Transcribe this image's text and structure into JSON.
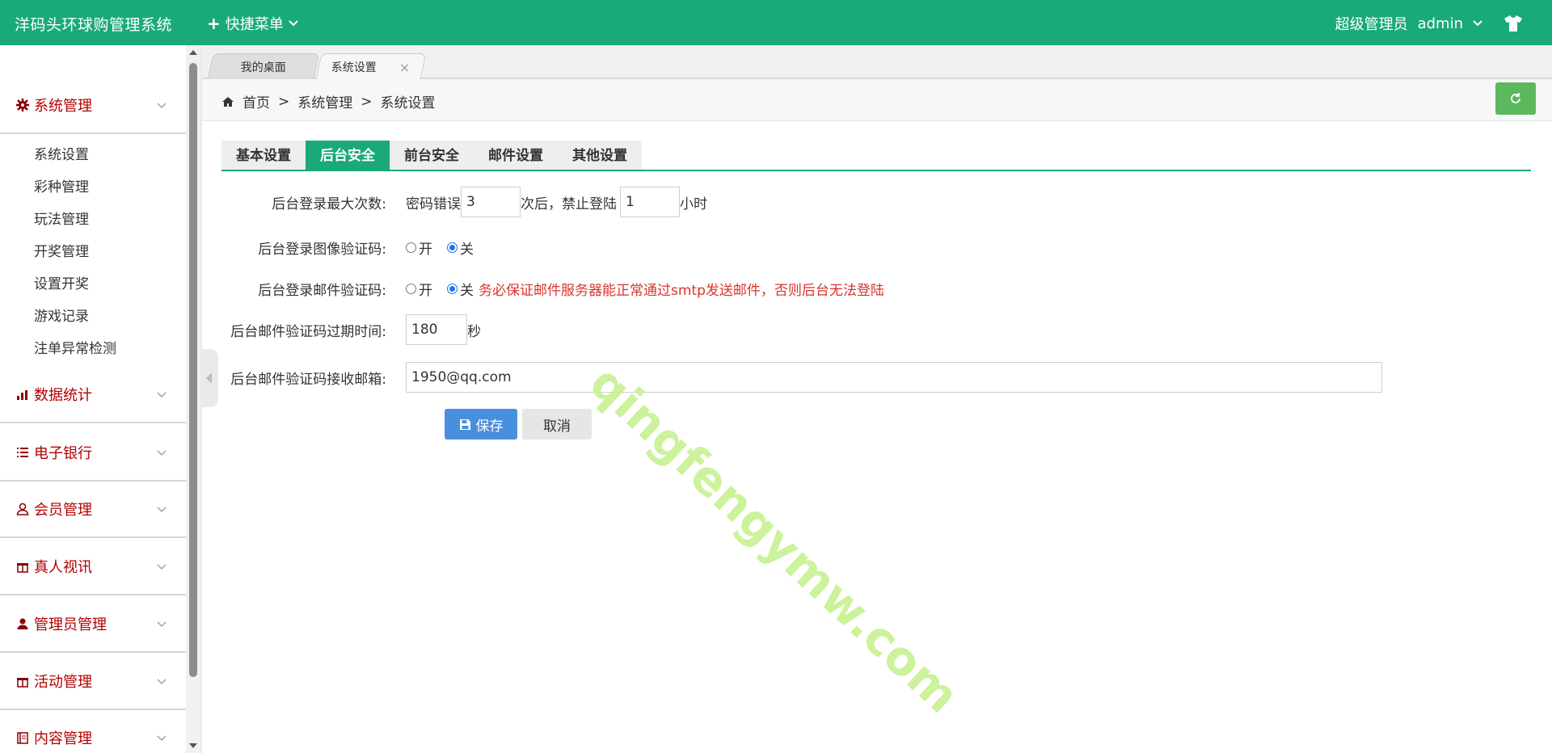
{
  "header": {
    "app_title": "洋码头环球购管理系统",
    "quick_menu": "快捷菜单",
    "role": "超级管理员",
    "username": "admin"
  },
  "sidebar": {
    "groups": [
      {
        "label": "系统管理",
        "icon": "gear-icon",
        "expanded": true,
        "items": [
          "系统设置",
          "彩种管理",
          "玩法管理",
          "开奖管理",
          "设置开奖",
          "游戏记录",
          "注单异常检测"
        ]
      },
      {
        "label": "数据统计",
        "icon": "bar-chart-icon"
      },
      {
        "label": "电子银行",
        "icon": "list-icon"
      },
      {
        "label": "会员管理",
        "icon": "user-icon"
      },
      {
        "label": "真人视讯",
        "icon": "gift-icon"
      },
      {
        "label": "管理员管理",
        "icon": "user-filled-icon"
      },
      {
        "label": "活动管理",
        "icon": "gift-icon"
      },
      {
        "label": "内容管理",
        "icon": "book-icon"
      }
    ]
  },
  "tabs": {
    "desktop": "我的桌面",
    "current": "系统设置",
    "close": "×"
  },
  "breadcrumb": {
    "home": "首页",
    "sep": ">",
    "level1": "系统管理",
    "level2": "系统设置"
  },
  "settings_tabs": [
    "基本设置",
    "后台安全",
    "前台安全",
    "邮件设置",
    "其他设置"
  ],
  "active_settings_tab": "后台安全",
  "form": {
    "max_login": {
      "label": "后台登录最大次数:",
      "prefix": "密码错误",
      "attempts": "3",
      "middle": "次后，禁止登陆",
      "hours": "1",
      "suffix": "小时"
    },
    "image_captcha": {
      "label": "后台登录图像验证码:",
      "on": "开",
      "off": "关",
      "selected": "关"
    },
    "email_captcha": {
      "label": "后台登录邮件验证码:",
      "on": "开",
      "off": "关",
      "selected": "关",
      "warning": "务必保证邮件服务器能正常通过smtp发送邮件，否则后台无法登陆"
    },
    "email_expire": {
      "label": "后台邮件验证码过期时间:",
      "value": "180",
      "unit": "秒"
    },
    "email_receiver": {
      "label": "后台邮件验证码接收邮箱:",
      "value": "1950@qq.com"
    },
    "save": "保存",
    "cancel": "取消"
  },
  "watermark": "qingfengymw.com",
  "colors": {
    "primary": "#1aa97b",
    "menu_text": "#b40000",
    "warning": "#d9342b",
    "save_button": "#4a8fde",
    "refresh_button": "#5cb85c"
  }
}
